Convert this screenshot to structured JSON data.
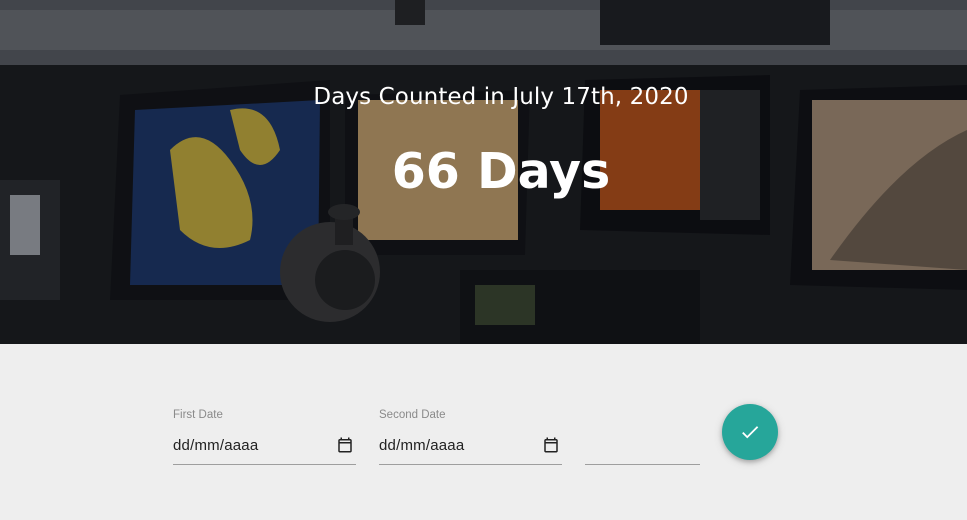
{
  "hero": {
    "subtitle": "Days Counted in July 17th, 2020",
    "title": "66 Days"
  },
  "form": {
    "first_date": {
      "label": "First Date",
      "value": "dd/mm/aaaa",
      "icon": "calendar-icon"
    },
    "second_date": {
      "label": "Second Date",
      "value": "dd/mm/aaaa",
      "icon": "calendar-icon"
    },
    "third_field": {
      "value": ""
    },
    "submit": {
      "icon": "check-icon",
      "color": "#26a69a"
    }
  }
}
